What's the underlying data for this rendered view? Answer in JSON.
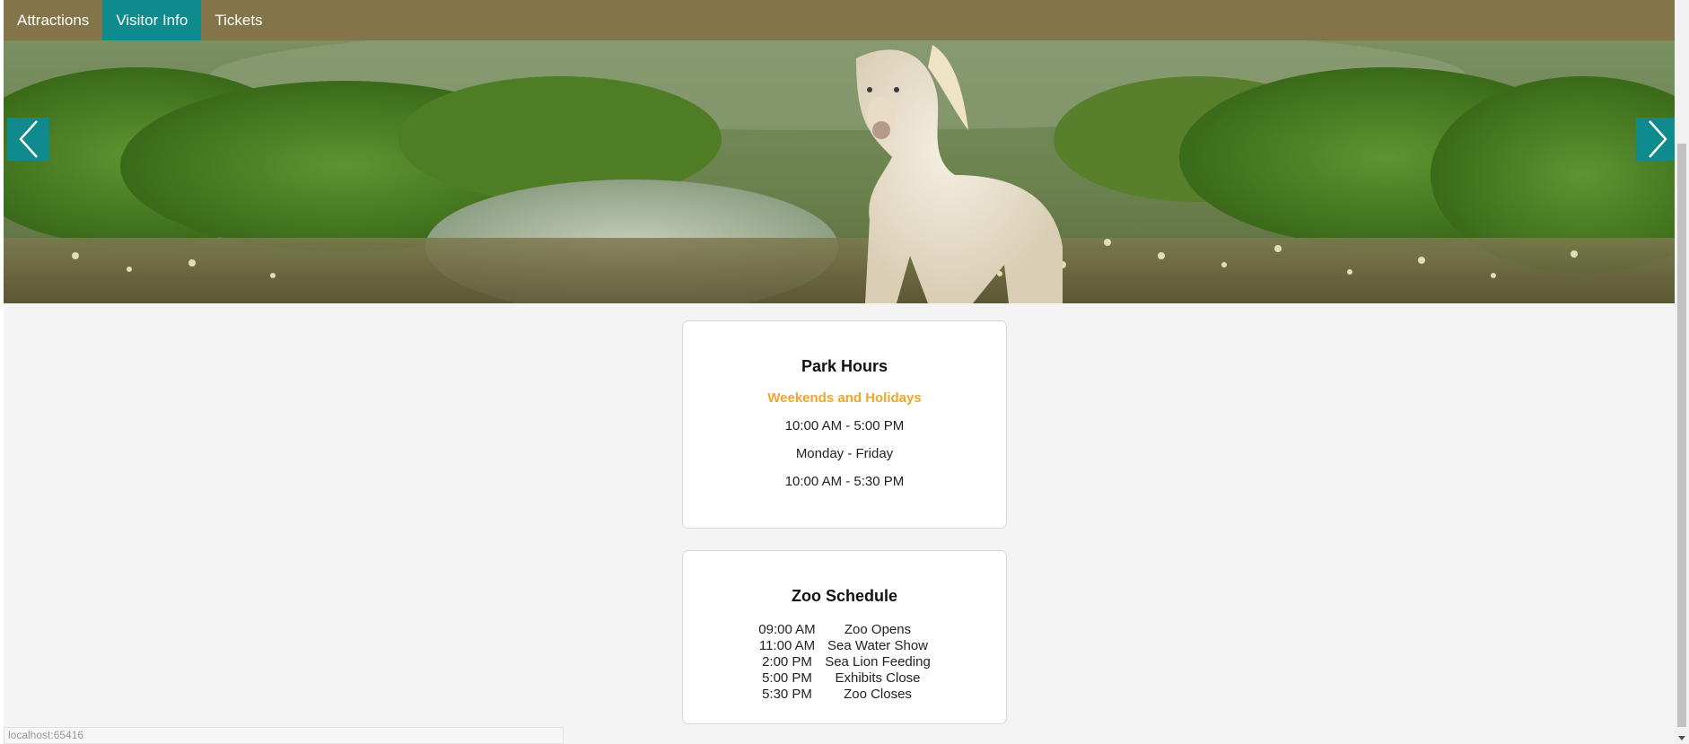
{
  "nav": {
    "items": [
      {
        "label": "Attractions",
        "active": false
      },
      {
        "label": "Visitor Info",
        "active": true
      },
      {
        "label": "Tickets",
        "active": false
      }
    ],
    "bar_color": "#84744a",
    "active_color": "#0f8b8d"
  },
  "hero": {
    "icons": {
      "prev": "chevron-left-icon",
      "next": "chevron-right-icon"
    }
  },
  "park_hours": {
    "title": "Park Hours",
    "subheading": "Weekends and Holidays",
    "weekend_hours": "10:00 AM - 5:00 PM",
    "weekday_label": "Monday - Friday",
    "weekday_hours": "10:00 AM - 5:30 PM",
    "accent_color": "#f2a52b"
  },
  "zoo_schedule": {
    "title": "Zoo Schedule",
    "rows": [
      {
        "time": "09:00 AM",
        "event": "Zoo Opens"
      },
      {
        "time": "11:00 AM",
        "event": "Sea Water Show"
      },
      {
        "time": "2:00 PM",
        "event": "Sea Lion Feeding"
      },
      {
        "time": "5:00 PM",
        "event": "Exhibits Close"
      },
      {
        "time": "5:30 PM",
        "event": "Zoo Closes"
      }
    ]
  },
  "status_bar": {
    "url": "localhost:65416"
  }
}
